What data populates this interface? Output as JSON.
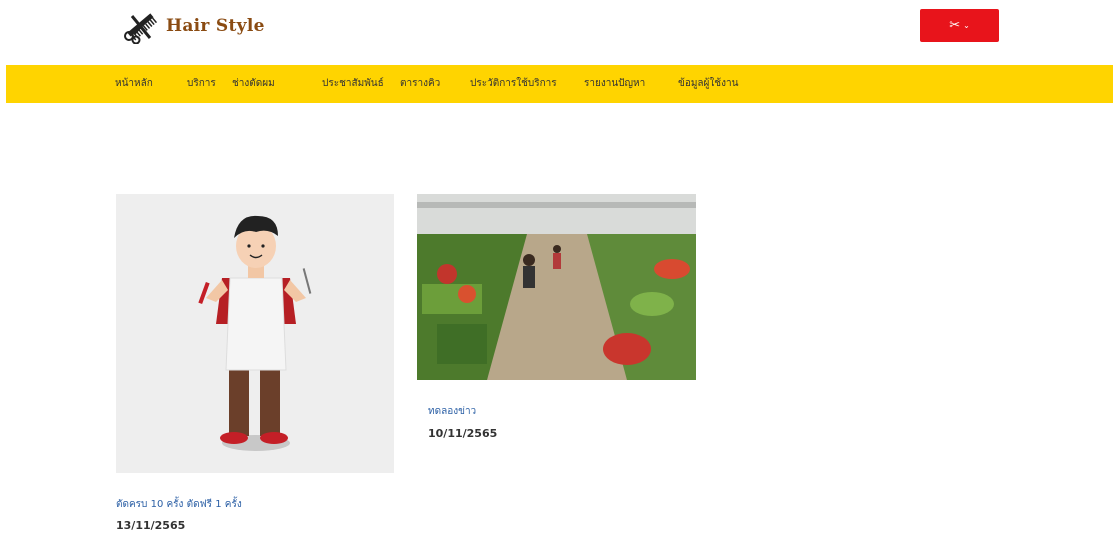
{
  "header": {
    "brand": "Hair Style",
    "logo_icon": "scissors-comb-icon",
    "menu_button_icon": "scissors-icon",
    "menu_chevron": "chevron-down-icon",
    "accent_color": "#e8141b",
    "navbar_color": "#ffd400"
  },
  "nav": {
    "items": [
      {
        "label": "หน้าหลัก"
      },
      {
        "label": "บริการ"
      },
      {
        "label": "ช่างตัดผม"
      },
      {
        "label": "ประชาสัมพันธ์"
      },
      {
        "label": "ตารางคิว"
      },
      {
        "label": "ประวัติการใช้บริการ"
      },
      {
        "label": "รายงานปัญหา"
      },
      {
        "label": "ข้อมูลผู้ใช้งาน"
      }
    ]
  },
  "posts": [
    {
      "title": "ตัดครบ 10 ครั้ง ตัดฟรี 1 ครั้ง",
      "date": "13/11/2565",
      "image": "barber-cartoon-illustration"
    },
    {
      "title": "ทดลองข่าว",
      "date": "10/11/2565",
      "image": "fresh-market-photo"
    }
  ]
}
